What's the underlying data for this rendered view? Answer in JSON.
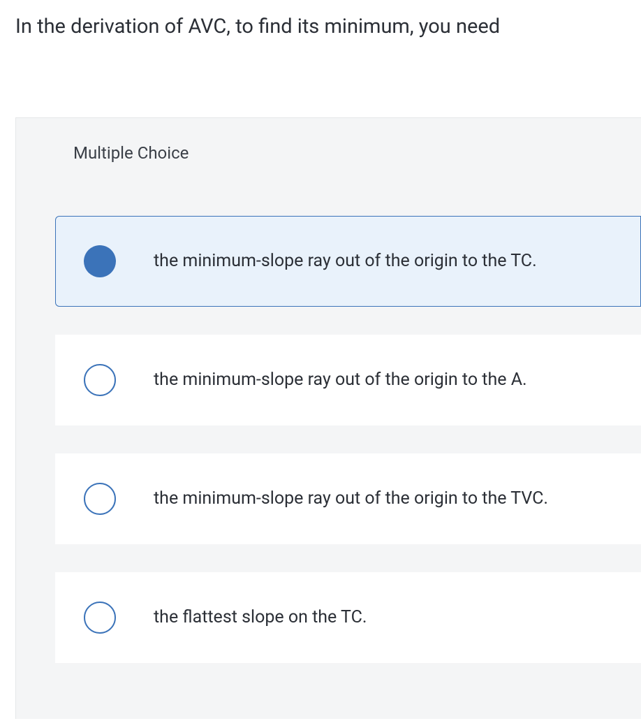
{
  "question": "In the derivation of AVC, to find its minimum, you need",
  "section_label": "Multiple Choice",
  "options": [
    {
      "label": "the minimum-slope ray out of the origin to the TC.",
      "selected": true
    },
    {
      "label": "the minimum-slope ray out of the origin to the A.",
      "selected": false
    },
    {
      "label": "the minimum-slope ray out of the origin to the TVC.",
      "selected": false
    },
    {
      "label": "the flattest slope on the TC.",
      "selected": false
    }
  ]
}
